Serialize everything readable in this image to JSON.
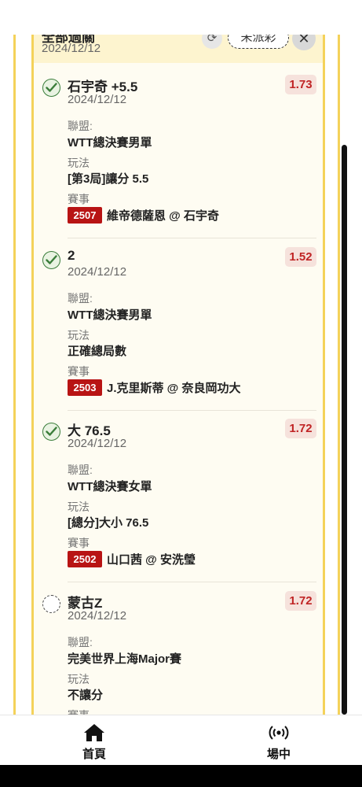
{
  "header": {
    "title": "全部過關",
    "date": "2024/12/12",
    "status_label": "未派彩",
    "refresh_icon": "refresh-icon",
    "close_icon": "close-icon"
  },
  "labels": {
    "league": "聯盟:",
    "play": "玩法",
    "match": "賽事"
  },
  "bets": [
    {
      "status": "won",
      "title": "石宇奇 +5.5",
      "date": "2024/12/12",
      "odds": "1.73",
      "league": "WTT總決賽男單",
      "play": "[第3局]讓分 5.5",
      "match_code": "2507",
      "match_name": "維帝德薩恩 @ 石宇奇"
    },
    {
      "status": "won",
      "title": "2",
      "date": "2024/12/12",
      "odds": "1.52",
      "league": "WTT總決賽男單",
      "play": "正確總局數",
      "match_code": "2503",
      "match_name": "J.克里斯蒂 @ 奈良岡功大"
    },
    {
      "status": "won",
      "title": "大 76.5",
      "date": "2024/12/12",
      "odds": "1.72",
      "league": "WTT總決賽女單",
      "play": "[總分]大小 76.5",
      "match_code": "2502",
      "match_name": "山口茜 @ 安洗瑩"
    },
    {
      "status": "pending",
      "title": "蒙古Z",
      "date": "2024/12/12",
      "odds": "1.72",
      "league": "完美世界上海Major賽",
      "play": "不讓分",
      "match_code": "",
      "match_name": ""
    }
  ],
  "nav": {
    "items": [
      {
        "label": "首頁",
        "icon": "home-icon"
      },
      {
        "label": "場中",
        "icon": "live-broadcast-icon"
      }
    ]
  },
  "colors": {
    "panel_bg": "#fefcf2",
    "frame_yellow": "#f4d25a",
    "odds_red": "#c02525",
    "match_badge": "#b81414",
    "check_green": "#3a7d3a"
  }
}
